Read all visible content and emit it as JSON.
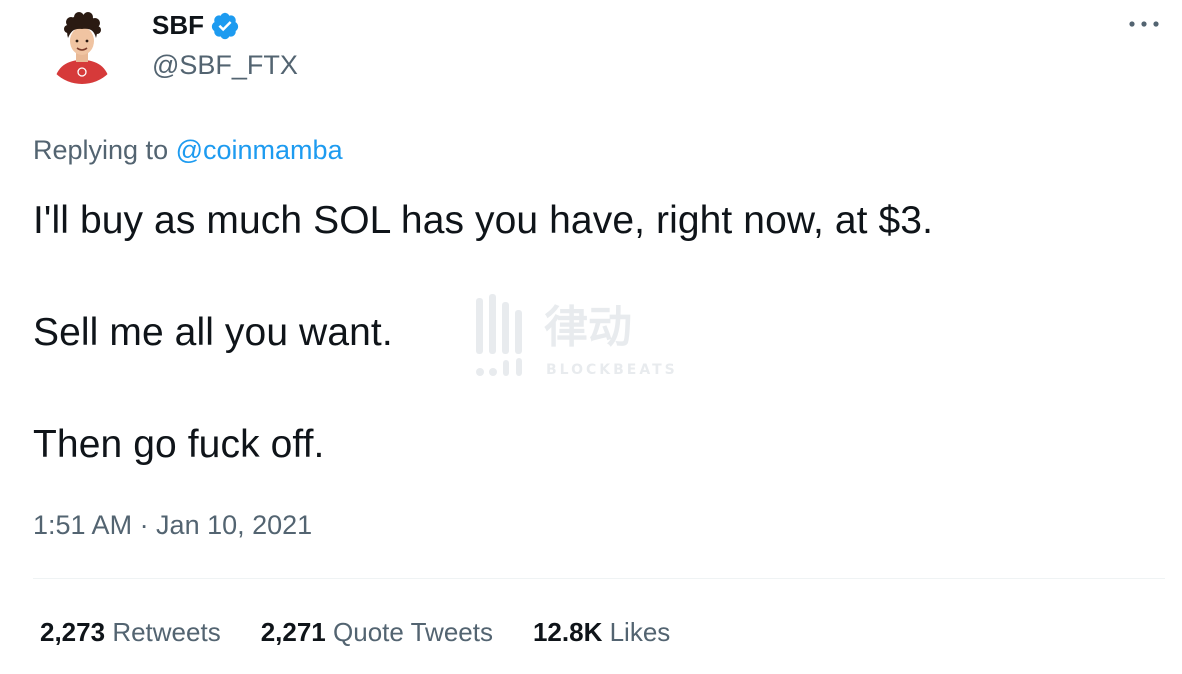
{
  "author": {
    "display_name": "SBF",
    "handle": "@SBF_FTX",
    "verified": true,
    "avatar_icon": "profile-avatar"
  },
  "reply": {
    "prefix": "Replying to",
    "to": "@coinmamba"
  },
  "tweet": {
    "lines": [
      "I'll buy as much SOL has you have, right now, at $3.",
      "Sell me all you want.",
      "Then go fuck off."
    ],
    "timestamp": "1:51 AM · Jan 10, 2021"
  },
  "stats": [
    {
      "count": "2,273",
      "label": "Retweets"
    },
    {
      "count": "2,271",
      "label": "Quote Tweets"
    },
    {
      "count": "12.8K",
      "label": "Likes"
    }
  ],
  "watermark": {
    "text_cn": "律动",
    "text_en": "BLOCKBEATS"
  },
  "colors": {
    "text": "#0f1419",
    "secondary": "#536471",
    "link": "#1d9bf0",
    "divider": "#eff3f4"
  }
}
